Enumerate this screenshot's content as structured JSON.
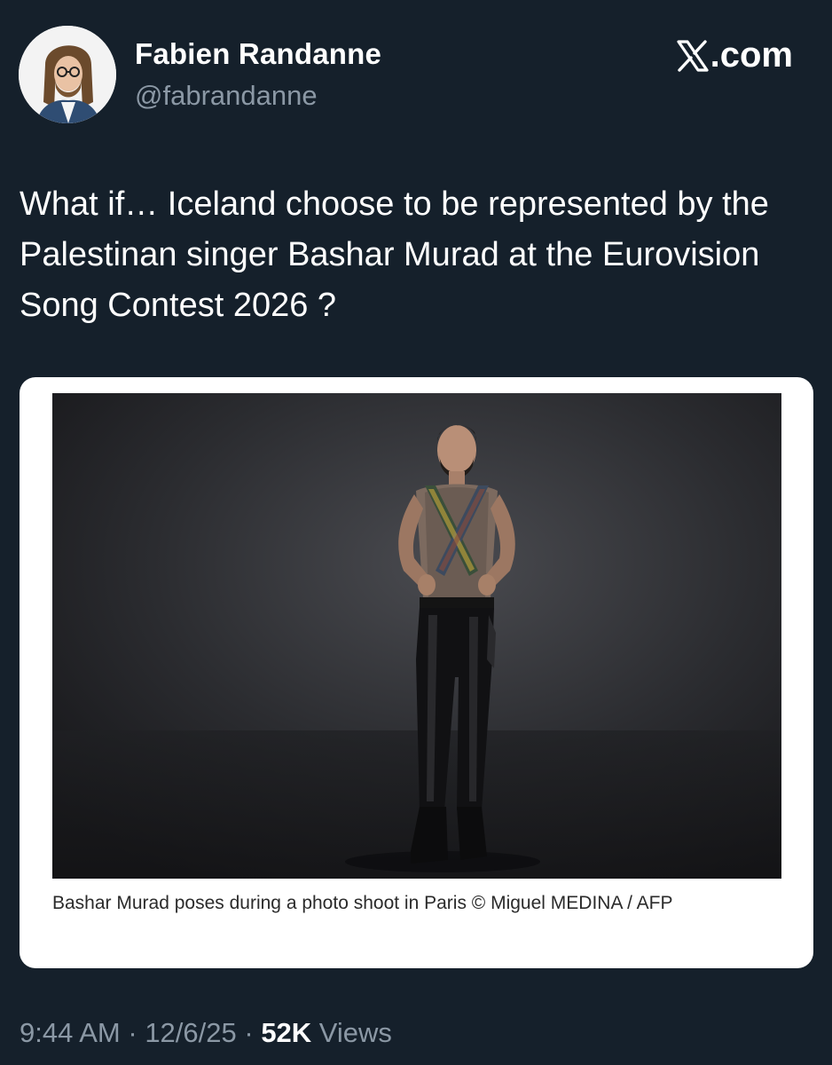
{
  "author": {
    "name": "Fabien Randanne",
    "handle": "@fabrandanne"
  },
  "brand": {
    "text": ".com",
    "icon": "x-logo-icon"
  },
  "tweet": {
    "text": "What if… Iceland choose to be represented by the Palestinan singer Bashar Murad at the Eurovision Song Contest 2026 ?"
  },
  "media": {
    "caption": "Bashar Murad poses during a photo shoot in Paris © Miguel MEDINA / AFP"
  },
  "meta": {
    "time": "9:44 AM",
    "separator1": " · ",
    "date": "12/6/25",
    "separator2": " · ",
    "views_count": "52K",
    "views_label": " Views"
  },
  "colors": {
    "background": "#15202b",
    "secondary_text": "#8b98a5",
    "card_background": "#ffffff"
  }
}
